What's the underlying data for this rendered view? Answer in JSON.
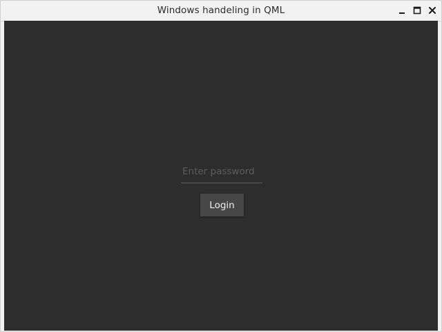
{
  "window": {
    "title": "Windows handeling in QML",
    "controls": {
      "minimize": "minimize-icon",
      "maximize": "maximize-icon",
      "close": "close-icon"
    }
  },
  "login": {
    "password_value": "",
    "password_placeholder": "Enter password",
    "button_label": "Login"
  },
  "colors": {
    "content_background": "#2d2d2d",
    "titlebar_background": "#f2f2f2",
    "button_background": "#474747",
    "placeholder_text": "#5c5c5c"
  }
}
